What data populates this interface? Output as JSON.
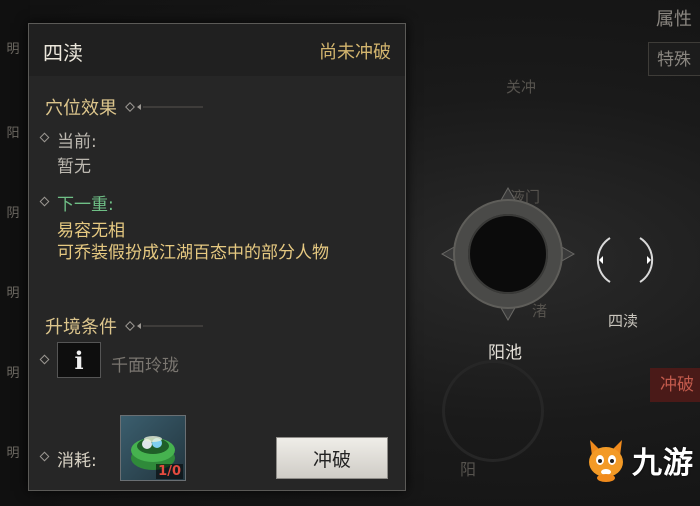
{
  "panel": {
    "title": "四渎",
    "status": "尚未冲破",
    "effects": {
      "heading": "穴位效果",
      "current_label": "当前:",
      "current_value": "暂无",
      "next_label": "下一重:",
      "next_name": "易容无相",
      "next_desc": "可乔装假扮成江湖百态中的部分人物"
    },
    "upgrade": {
      "heading": "升境条件",
      "requirement_icon": "info-icon",
      "requirement_glyph": "i",
      "requirement_text": "千面玲珑"
    },
    "cost": {
      "label": "消耗:",
      "item_icon": "green-pot-icon",
      "item_count": "1/0"
    },
    "break_button": "冲破"
  },
  "background": {
    "attribute_label": "属性",
    "special_label": "特殊",
    "guan_chong": "关冲",
    "ye_men": "液门",
    "zhong": "渚",
    "yang_chi": "阳池",
    "si_du": "四渎",
    "yang": "阳",
    "break_tag": "冲破",
    "left_strip": [
      "明",
      "阳",
      "阴",
      "明",
      "明",
      "明"
    ]
  },
  "watermark": {
    "text": "九游"
  },
  "colors": {
    "accent_gold": "#dcc58c",
    "status_gold": "#d3b56e",
    "next_green": "#6fbf86",
    "count_red": "#e34b3f"
  }
}
